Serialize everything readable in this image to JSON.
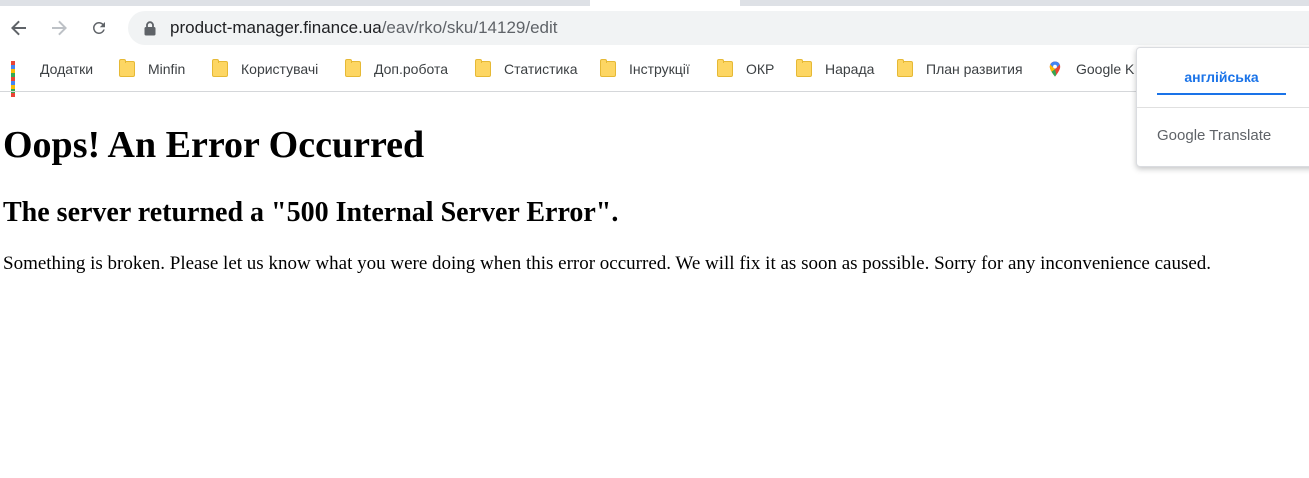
{
  "browser": {
    "url_host": "product-manager.finance.ua",
    "url_path": "/eav/rko/sku/14129/edit",
    "bookmarks": [
      {
        "label": "Додатки",
        "icon": "apps-icon"
      },
      {
        "label": "Minfin",
        "icon": "folder-icon"
      },
      {
        "label": "Користувачі",
        "icon": "folder-icon"
      },
      {
        "label": "Доп.робота",
        "icon": "folder-icon"
      },
      {
        "label": "Статистика",
        "icon": "folder-icon"
      },
      {
        "label": "Інструкції",
        "icon": "folder-icon"
      },
      {
        "label": "ОКР",
        "icon": "folder-icon"
      },
      {
        "label": "Нарада",
        "icon": "folder-icon"
      },
      {
        "label": "План развития",
        "icon": "folder-icon"
      },
      {
        "label": "Google K",
        "icon": "google-maps-icon"
      }
    ]
  },
  "page": {
    "title": "Oops! An Error Occurred",
    "subtitle": "The server returned a \"500 Internal Server Error\".",
    "message": "Something is broken. Please let us know what you were doing when this error occurred. We will fix it as soon as possible. Sorry for any inconvenience caused."
  },
  "translate_popup": {
    "language_tab": "англійська",
    "brand": "Google Translate"
  },
  "colors": {
    "accent": "#1a73e8",
    "folder": "#fdd663",
    "omnibox_bg": "#f1f3f4"
  }
}
